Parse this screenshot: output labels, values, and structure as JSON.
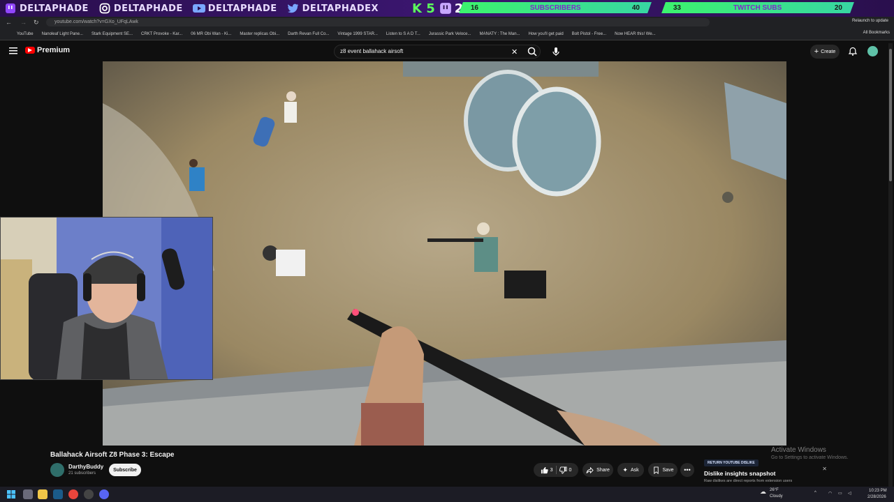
{
  "overlay": {
    "socials": [
      {
        "icon": "twitch-icon",
        "name": "DELTAPHADE"
      },
      {
        "icon": "instagram-icon",
        "name": "DELTAPHADE"
      },
      {
        "icon": "youtube-icon",
        "name": "DELTAPHADE"
      },
      {
        "icon": "twitter-icon",
        "name": "DELTAPHADEX"
      }
    ],
    "k5": "K 5",
    "p2_label": "2",
    "subs_goal": {
      "current": "16",
      "label": "SUBSCRIBERS",
      "target": "40"
    },
    "twitch_goal": {
      "current": "33",
      "label": "TWITCH SUBS",
      "target": "20"
    }
  },
  "browser": {
    "url": "youtube.com/watch?v=GXo_UFqLAwk",
    "update_label": "Relaunch to update",
    "bookmarks": [
      "YouTube",
      "Nanoleaf Light Pane...",
      "Stark Equipment SE...",
      "CRKT Provoke - Kar...",
      "06 MR Obi Wan - Ki...",
      "Master replicas Obi...",
      "Darth Revan Full Co...",
      "Vintage 1999 STAR...",
      "Listen to S A D T...",
      "Jurassic Park Veloce...",
      "MANATY : The Man...",
      "How you'll get paid",
      "Bolt Pistol - Free...",
      "Now HEAR this! We..."
    ],
    "all_bookmarks": "All Bookmarks"
  },
  "youtube": {
    "logo_text": "Premium",
    "search_value": "z8 event ballahack airsoft",
    "create_label": "Create",
    "video_title": "Ballahack Airsoft Z8 Phase 3: Escape",
    "channel_name": "DarthyBuddy",
    "channel_subs": "21 subscribers",
    "subscribe_label": "Subscribe",
    "likes": "3",
    "dislikes": "0",
    "share_label": "Share",
    "ask_label": "Ask",
    "save_label": "Save"
  },
  "dislike_panel": {
    "tag": "RETURN YOUTUBE DISLIKE",
    "heading": "Dislike insights snapshot",
    "body": "Raw dislikes are direct reports from extension users"
  },
  "activate": {
    "line1": "Activate Windows",
    "line2": "Go to Settings to activate Windows."
  },
  "taskbar": {
    "weather_temp": "26°F",
    "weather_desc": "Cloudy",
    "time": "10:23 PM",
    "date": "2/28/2026"
  }
}
